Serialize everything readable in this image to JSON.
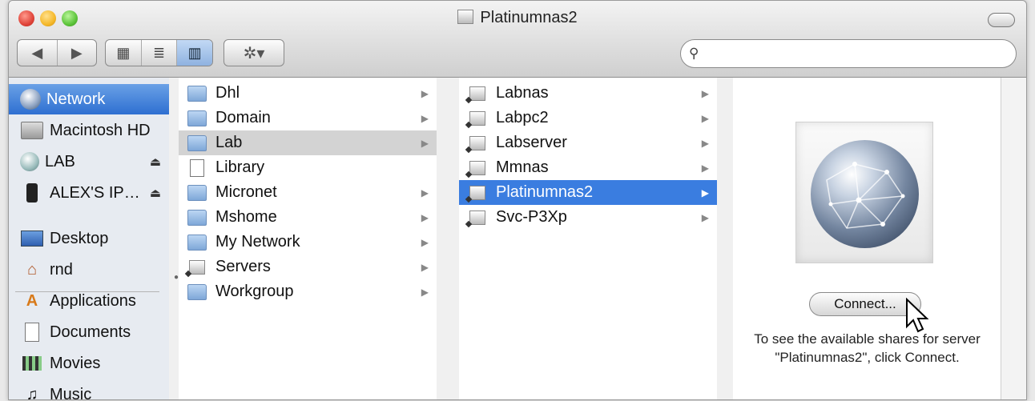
{
  "window": {
    "title": "Platinumnas2"
  },
  "toolbar": {
    "back": "◀",
    "forward": "▶",
    "view_icons": "▦",
    "view_list": "≣",
    "view_columns": "▥",
    "action": "✲▾",
    "search_placeholder": "",
    "search_icon": "search-icon"
  },
  "sidebar": {
    "devices": [
      {
        "label": "Network",
        "icon": "network-icon"
      },
      {
        "label": "Macintosh HD",
        "icon": "disk-icon"
      },
      {
        "label": "LAB",
        "icon": "shared-server-icon"
      },
      {
        "label": "ALEX'S IP…",
        "icon": "ipod-icon"
      }
    ],
    "places": [
      {
        "label": "Desktop",
        "icon": "desktop-icon"
      },
      {
        "label": "rnd",
        "icon": "home-icon"
      },
      {
        "label": "Applications",
        "icon": "applications-icon"
      },
      {
        "label": "Documents",
        "icon": "documents-icon"
      },
      {
        "label": "Movies",
        "icon": "movies-icon"
      },
      {
        "label": "Music",
        "icon": "music-icon"
      }
    ]
  },
  "column1": [
    {
      "label": "Dhl",
      "type": "folder"
    },
    {
      "label": "Domain",
      "type": "folder"
    },
    {
      "label": "Lab",
      "type": "folder"
    },
    {
      "label": "Library",
      "type": "alias"
    },
    {
      "label": "Micronet",
      "type": "folder"
    },
    {
      "label": "Mshome",
      "type": "folder"
    },
    {
      "label": "My Network",
      "type": "folder"
    },
    {
      "label": "Servers",
      "type": "servers"
    },
    {
      "label": "Workgroup",
      "type": "folder"
    }
  ],
  "column2": [
    {
      "label": "Labnas"
    },
    {
      "label": "Labpc2"
    },
    {
      "label": "Labserver"
    },
    {
      "label": "Mmnas"
    },
    {
      "label": "Platinumnas2"
    },
    {
      "label": "Svc-P3Xp"
    }
  ],
  "preview": {
    "connect_label": "Connect...",
    "hint": "To see the available shares for server \"Platinumnas2\", click Connect."
  },
  "colors": {
    "selection_blue": "#3a7de0",
    "sidebar_selected": "#2e6fd1"
  }
}
